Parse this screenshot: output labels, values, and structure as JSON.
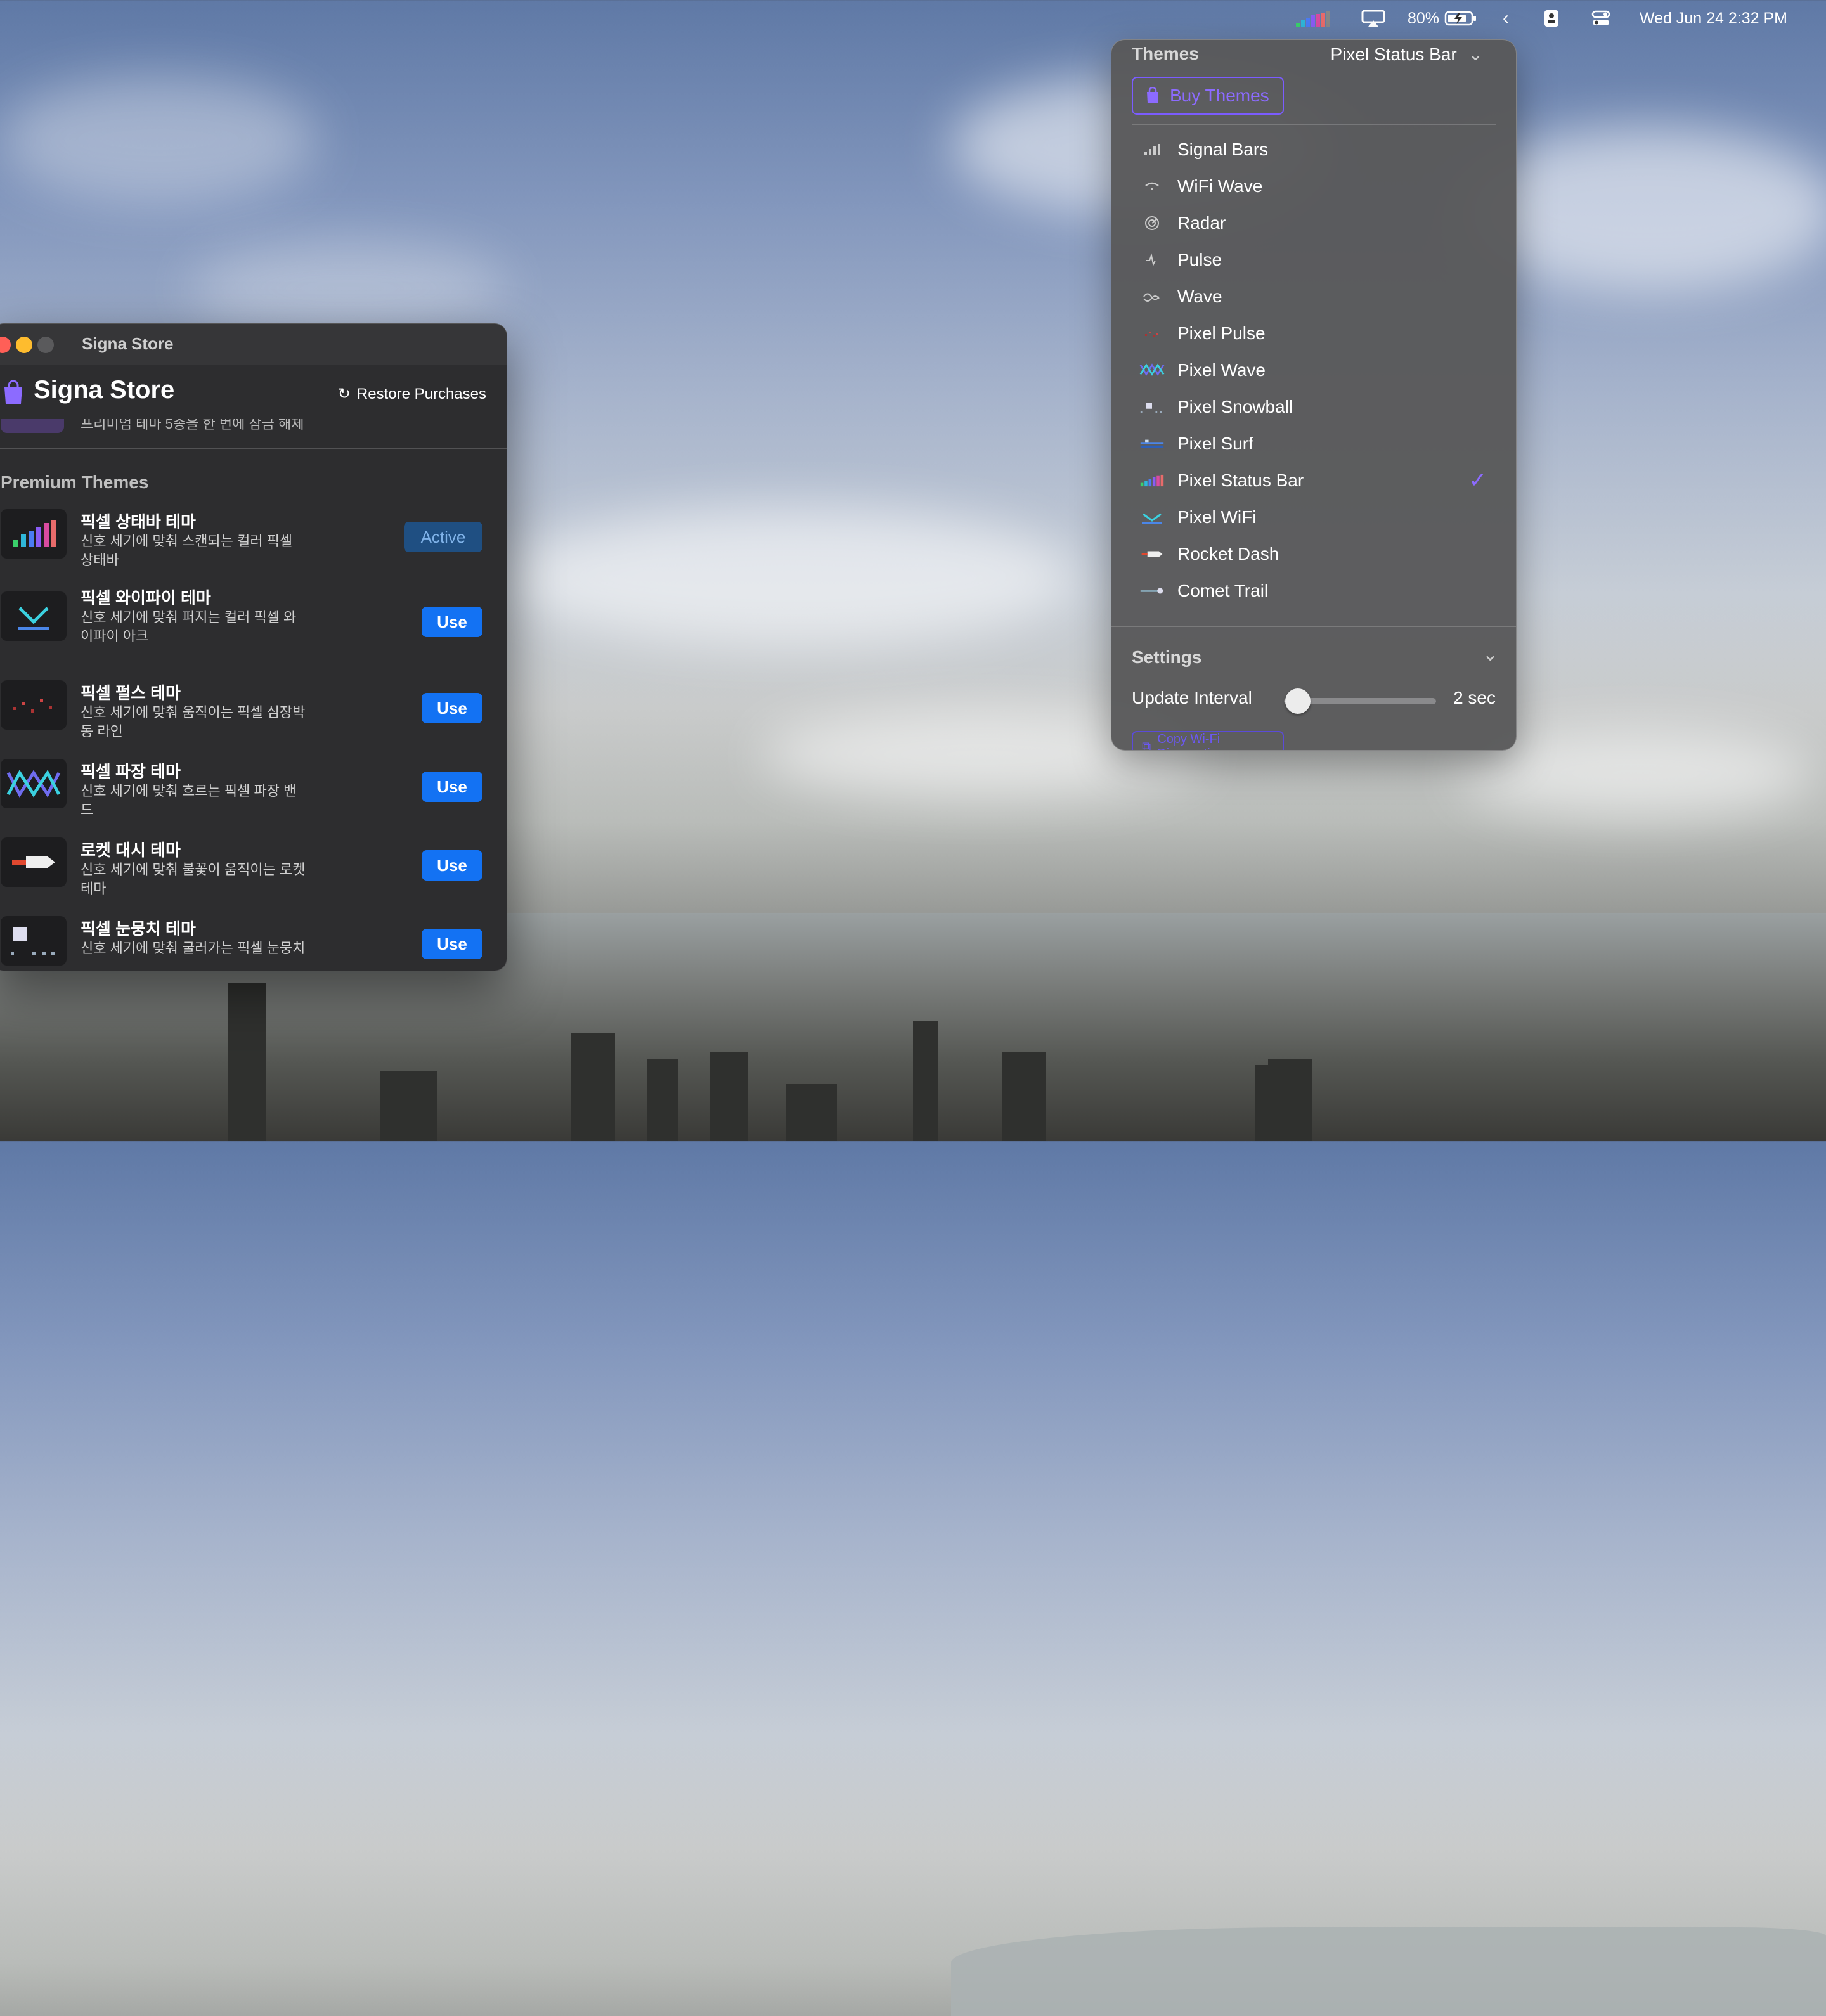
{
  "menubar": {
    "battery_percent": "80%",
    "datetime": "Wed Jun 24  2:32 PM",
    "icons": [
      "pixel-status-bar-icon",
      "airplay-icon",
      "battery-icon",
      "chevron-left-icon",
      "contact-card-icon",
      "control-center-icon"
    ]
  },
  "panel": {
    "themes_title": "Themes",
    "current_theme": "Pixel Status Bar",
    "buy_label": "Buy Themes",
    "themes": [
      {
        "label": "Signal Bars",
        "icon": "signal-bars-icon"
      },
      {
        "label": "WiFi Wave",
        "icon": "wifi-wave-icon"
      },
      {
        "label": "Radar",
        "icon": "radar-icon"
      },
      {
        "label": "Pulse",
        "icon": "pulse-icon"
      },
      {
        "label": "Wave",
        "icon": "wave-icon"
      },
      {
        "label": "Pixel Pulse",
        "icon": "pixel-pulse-icon"
      },
      {
        "label": "Pixel Wave",
        "icon": "pixel-wave-icon"
      },
      {
        "label": "Pixel Snowball",
        "icon": "pixel-snowball-icon"
      },
      {
        "label": "Pixel Surf",
        "icon": "pixel-surf-icon"
      },
      {
        "label": "Pixel Status Bar",
        "icon": "pixel-status-bar-icon",
        "selected": true
      },
      {
        "label": "Pixel WiFi",
        "icon": "pixel-wifi-icon"
      },
      {
        "label": "Rocket Dash",
        "icon": "rocket-dash-icon"
      },
      {
        "label": "Comet Trail",
        "icon": "comet-trail-icon"
      }
    ],
    "settings_title": "Settings",
    "update_interval_label": "Update Interval",
    "update_interval_value": "2 sec",
    "copy_label": "Copy Wi-Fi Diagnostics"
  },
  "store": {
    "window_title": "Signa Store",
    "header_title": "Signa Store",
    "restore_label": "Restore Purchases",
    "clipped_text": "프리미엄 테마 5종을 한 번에 잠금 해제",
    "section_title": "Premium Themes",
    "items": [
      {
        "name": "픽셀 상태바 테마",
        "desc": "신호 세기에 맞춰 스캔되는 컬러 픽셀 상태바",
        "action": "Active"
      },
      {
        "name": "픽셀 와이파이 테마",
        "desc": "신호 세기에 맞춰 퍼지는 컬러 픽셀 와이파이 아크",
        "action": "Use"
      },
      {
        "name": "픽셀 펄스 테마",
        "desc": "신호 세기에 맞춰 움직이는 픽셀 심장박동 라인",
        "action": "Use"
      },
      {
        "name": "픽셀 파장 테마",
        "desc": "신호 세기에 맞춰 흐르는 픽셀 파장 밴드",
        "action": "Use"
      },
      {
        "name": "로켓 대시 테마",
        "desc": "신호 세기에 맞춰 불꽃이 움직이는 로켓 테마",
        "action": "Use"
      },
      {
        "name": "픽셀 눈뭉치 테마",
        "desc": "신호 세기에 맞춰 굴러가는 픽셀 눈뭉치",
        "action": "Use"
      }
    ]
  },
  "colors": {
    "accent": "#8c6bff",
    "use_button": "#1372f3",
    "active_button": "#1f4f82"
  }
}
